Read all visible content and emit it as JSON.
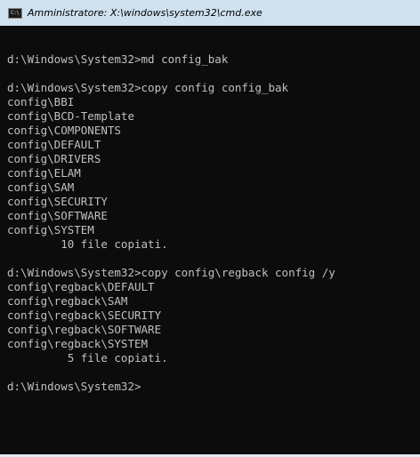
{
  "window": {
    "title": "Amministratore: X:\\windows\\system32\\cmd.exe",
    "icon_label": "C:\\"
  },
  "console": {
    "lines": [
      "",
      "d:\\Windows\\System32>md config_bak",
      "",
      "d:\\Windows\\System32>copy config config_bak",
      "config\\BBI",
      "config\\BCD-Template",
      "config\\COMPONENTS",
      "config\\DEFAULT",
      "config\\DRIVERS",
      "config\\ELAM",
      "config\\SAM",
      "config\\SECURITY",
      "config\\SOFTWARE",
      "config\\SYSTEM",
      "        10 file copiati.",
      "",
      "d:\\Windows\\System32>copy config\\regback config /y",
      "config\\regback\\DEFAULT",
      "config\\regback\\SAM",
      "config\\regback\\SECURITY",
      "config\\regback\\SOFTWARE",
      "config\\regback\\SYSTEM",
      "         5 file copiati.",
      "",
      "d:\\Windows\\System32>"
    ]
  },
  "colors": {
    "console_bg": "#0c0c0c",
    "console_fg": "#c0c0c0",
    "titlebar_bg": "#cfe0ee"
  }
}
